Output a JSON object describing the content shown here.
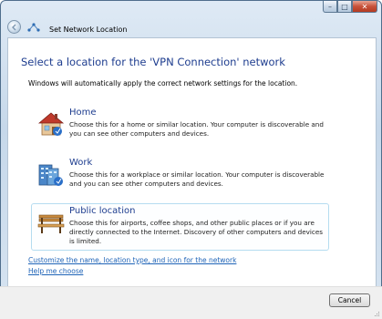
{
  "window": {
    "title": "Set Network Location",
    "controls": {
      "minimize": "–",
      "maximize": "□",
      "close": "✕"
    }
  },
  "main": {
    "heading": "Select a location for the 'VPN Connection' network",
    "intro": "Windows will automatically apply the correct network settings for the location."
  },
  "options": [
    {
      "title": "Home",
      "description": "Choose this for a home or similar location. Your computer is discoverable and you can see other computers and devices.",
      "icon": "house-icon"
    },
    {
      "title": "Work",
      "description": "Choose this for a workplace or similar location. Your computer is discoverable and you can see other computers and devices.",
      "icon": "office-building-icon"
    },
    {
      "title": "Public location",
      "description": "Choose this for airports, coffee shops, and other public places or if you are directly connected to the Internet. Discovery of other computers and devices is limited.",
      "icon": "park-bench-icon"
    }
  ],
  "links": {
    "customize": "Customize the name, location type, and icon for the network",
    "help": "Help me choose"
  },
  "footer": {
    "cancel_label": "Cancel"
  }
}
